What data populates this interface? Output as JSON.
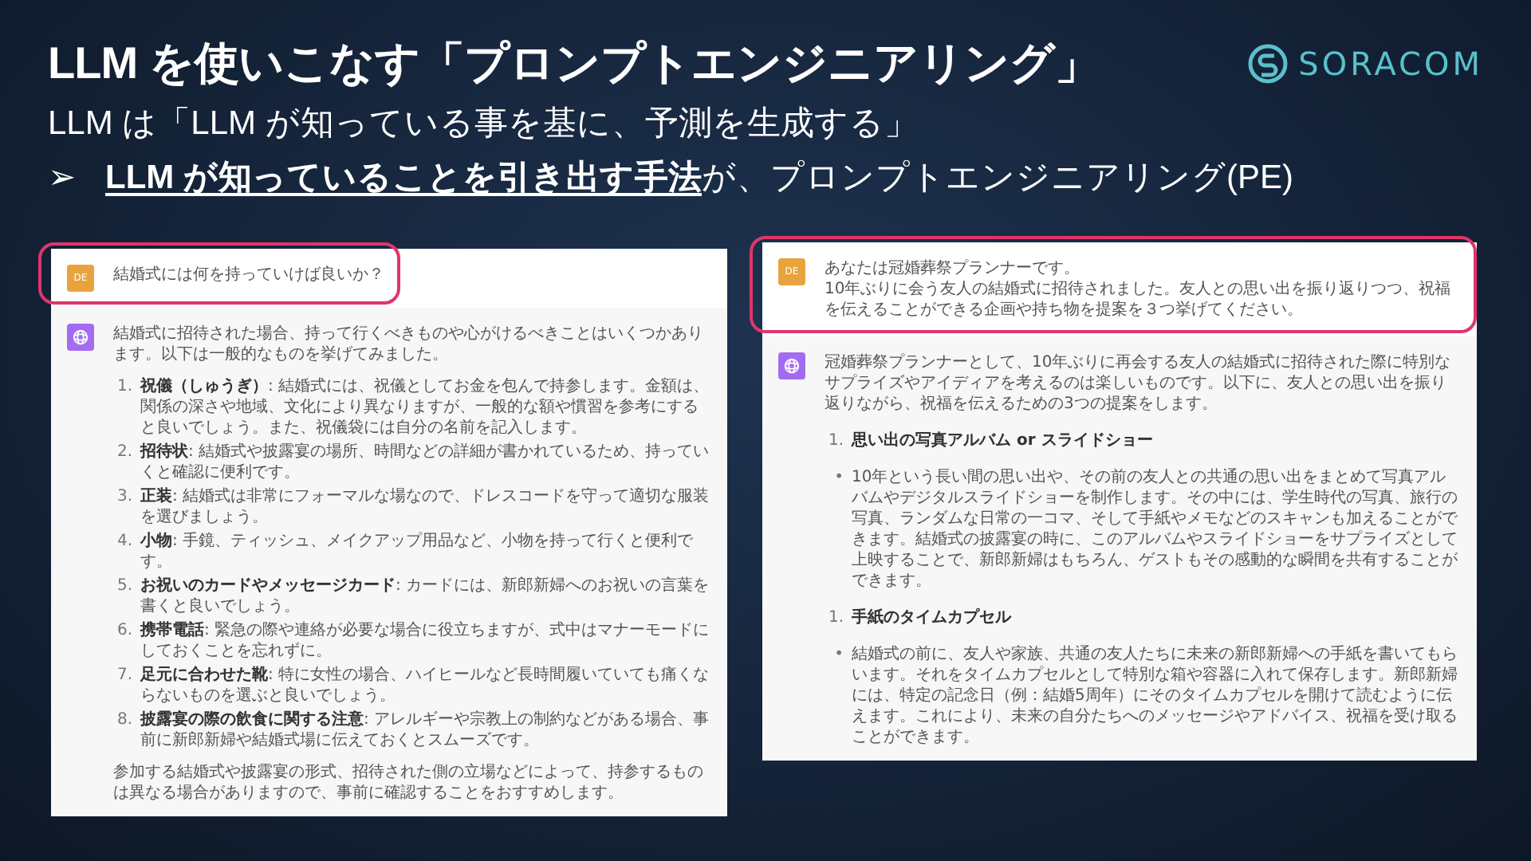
{
  "title": "LLM を使いこなす「プロンプトエンジニアリング」",
  "logo": {
    "text": "SORACOM"
  },
  "subtitle": "LLM は「LLM が知っている事を基に、予測を生成する」",
  "bullet": {
    "marker": "➢",
    "text": "**LLM が知っていることを引き出す手法**が、プロンプトエンジニアリング(PE)"
  },
  "panels": [
    {
      "messages": [
        {
          "kind": "user",
          "avatar": "DE",
          "highlighted": true,
          "lines": [
            "結婚式には何を持っていけば良いか？"
          ]
        },
        {
          "kind": "assistant",
          "blocks": [
            {
              "kind": "paragraph",
              "text": "結婚式に招待された場合、持って行くべきものや心がけるべきことはいくつかあります。以下は一般的なものを挙げてみました。"
            },
            {
              "kind": "numbered",
              "items": [
                {
                  "number": "1.",
                  "text": "**祝儀（しゅうぎ）**: 結婚式には、祝儀としてお金を包んで持参します。金額は、関係の深さや地域、文化により異なりますが、一般的な額や慣習を参考にすると良いでしょう。また、祝儀袋には自分の名前を記入します。"
                },
                {
                  "number": "2.",
                  "text": "**招待状**: 結婚式や披露宴の場所、時間などの詳細が書かれているため、持っていくと確認に便利です。"
                },
                {
                  "number": "3.",
                  "text": "**正装**: 結婚式は非常にフォーマルな場なので、ドレスコードを守って適切な服装を選びましょう。"
                },
                {
                  "number": "4.",
                  "text": "**小物**: 手鏡、ティッシュ、メイクアップ用品など、小物を持って行くと便利です。"
                },
                {
                  "number": "5.",
                  "text": "**お祝いのカードやメッセージカード**: カードには、新郎新婦へのお祝いの言葉を書くと良いでしょう。"
                },
                {
                  "number": "6.",
                  "text": "**携帯電話**: 緊急の際や連絡が必要な場合に役立ちますが、式中はマナーモードにしておくことを忘れずに。"
                },
                {
                  "number": "7.",
                  "text": "**足元に合わせた靴**: 特に女性の場合、ハイヒールなど長時間履いていても痛くならないものを選ぶと良いでしょう。"
                },
                {
                  "number": "8.",
                  "text": "**披露宴の際の飲食に関する注意**: アレルギーや宗教上の制約などがある場合、事前に新郎新婦や結婚式場に伝えておくとスムーズです。"
                }
              ]
            },
            {
              "kind": "paragraph",
              "text": "参加する結婚式や披露宴の形式、招待された側の立場などによって、持参するものは異なる場合がありますので、事前に確認することをおすすめします。"
            }
          ]
        }
      ]
    },
    {
      "messages": [
        {
          "kind": "user",
          "avatar": "DE",
          "highlighted": true,
          "lines": [
            "あなたは冠婚葬祭プランナーです。",
            "10年ぶりに会う友人の結婚式に招待されました。友人との思い出を振り返りつつ、祝福を伝えることができる企画や持ち物を提案を３つ挙げてください。"
          ]
        },
        {
          "kind": "assistant",
          "blocks": [
            {
              "kind": "paragraph",
              "text": "冠婚葬祭プランナーとして、10年ぶりに再会する友人の結婚式に招待された際に特別なサプライズやアイディアを考えるのは楽しいものです。以下に、友人との思い出を振り返りながら、祝福を伝えるための3つの提案をします。"
            },
            {
              "kind": "heading",
              "number": "1.",
              "text": "思い出の写真アルバム or スライドショー"
            },
            {
              "kind": "bullet",
              "marker": "•",
              "text": "10年という長い間の思い出や、その前の友人との共通の思い出をまとめて写真アルバムやデジタルスライドショーを制作します。その中には、学生時代の写真、旅行の写真、ランダムな日常の一コマ、そして手紙やメモなどのスキャンも加えることができます。結婚式の披露宴の時に、このアルバムやスライドショーをサプライズとして上映することで、新郎新婦はもちろん、ゲストもその感動的な瞬間を共有することができます。"
            },
            {
              "kind": "heading",
              "number": "1.",
              "text": "手紙のタイムカプセル"
            },
            {
              "kind": "bullet",
              "marker": "•",
              "text": "結婚式の前に、友人や家族、共通の友人たちに未来の新郎新婦への手紙を書いてもらいます。それをタイムカプセルとして特別な箱や容器に入れて保存します。新郎新婦には、特定の記念日（例：結婚5周年）にそのタイムカプセルを開けて読むように伝えます。これにより、未来の自分たちへのメッセージやアドバイス、祝福を受け取ることができます。"
            }
          ]
        }
      ]
    }
  ]
}
